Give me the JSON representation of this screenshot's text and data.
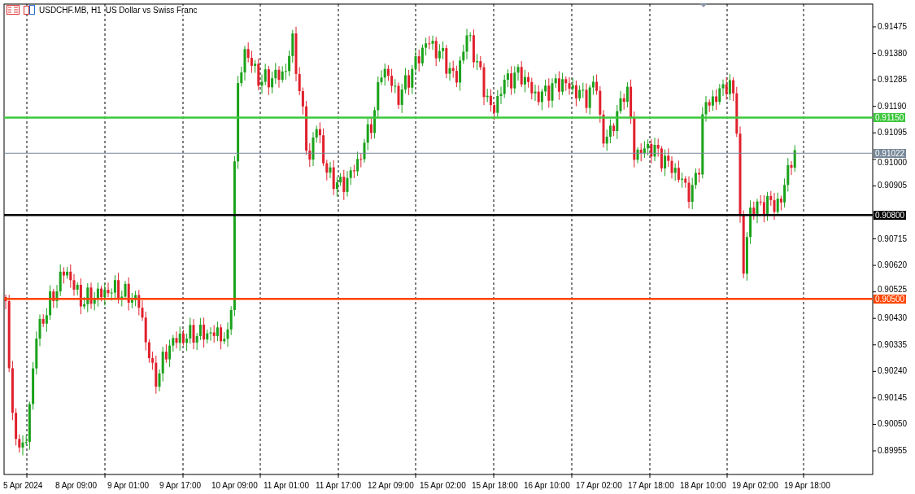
{
  "chart_header": {
    "symbol": "USDCHF.MB, H1",
    "description": "US Dollar vs Swiss Franc"
  },
  "price_axis": [
    "0.91475",
    "0.91380",
    "0.91285",
    "0.91190",
    "0.91095",
    "0.91000",
    "0.90905",
    "0.90715",
    "0.90620",
    "0.90525",
    "0.90430",
    "0.90335",
    "0.90240",
    "0.90145",
    "0.90050",
    "0.89955"
  ],
  "price_levels": [
    {
      "kind": "line",
      "label": "0.91150",
      "color": "#3cc83c"
    },
    {
      "kind": "bid",
      "label": "0.91022",
      "color": "#778899"
    },
    {
      "kind": "line",
      "label": "0.90800",
      "color": "#000000"
    },
    {
      "kind": "line",
      "label": "0.90500",
      "color": "#ff4500"
    }
  ],
  "time_axis": [
    "5 Apr 2024",
    "8 Apr 09:00",
    "9 Apr 01:00",
    "9 Apr 17:00",
    "10 Apr 09:00",
    "11 Apr 01:00",
    "11 Apr 17:00",
    "12 Apr 09:00",
    "15 Apr 02:00",
    "15 Apr 18:00",
    "16 Apr 10:00",
    "17 Apr 02:00",
    "17 Apr 18:00",
    "18 Apr 10:00",
    "19 Apr 02:00",
    "19 Apr 18:00"
  ]
}
